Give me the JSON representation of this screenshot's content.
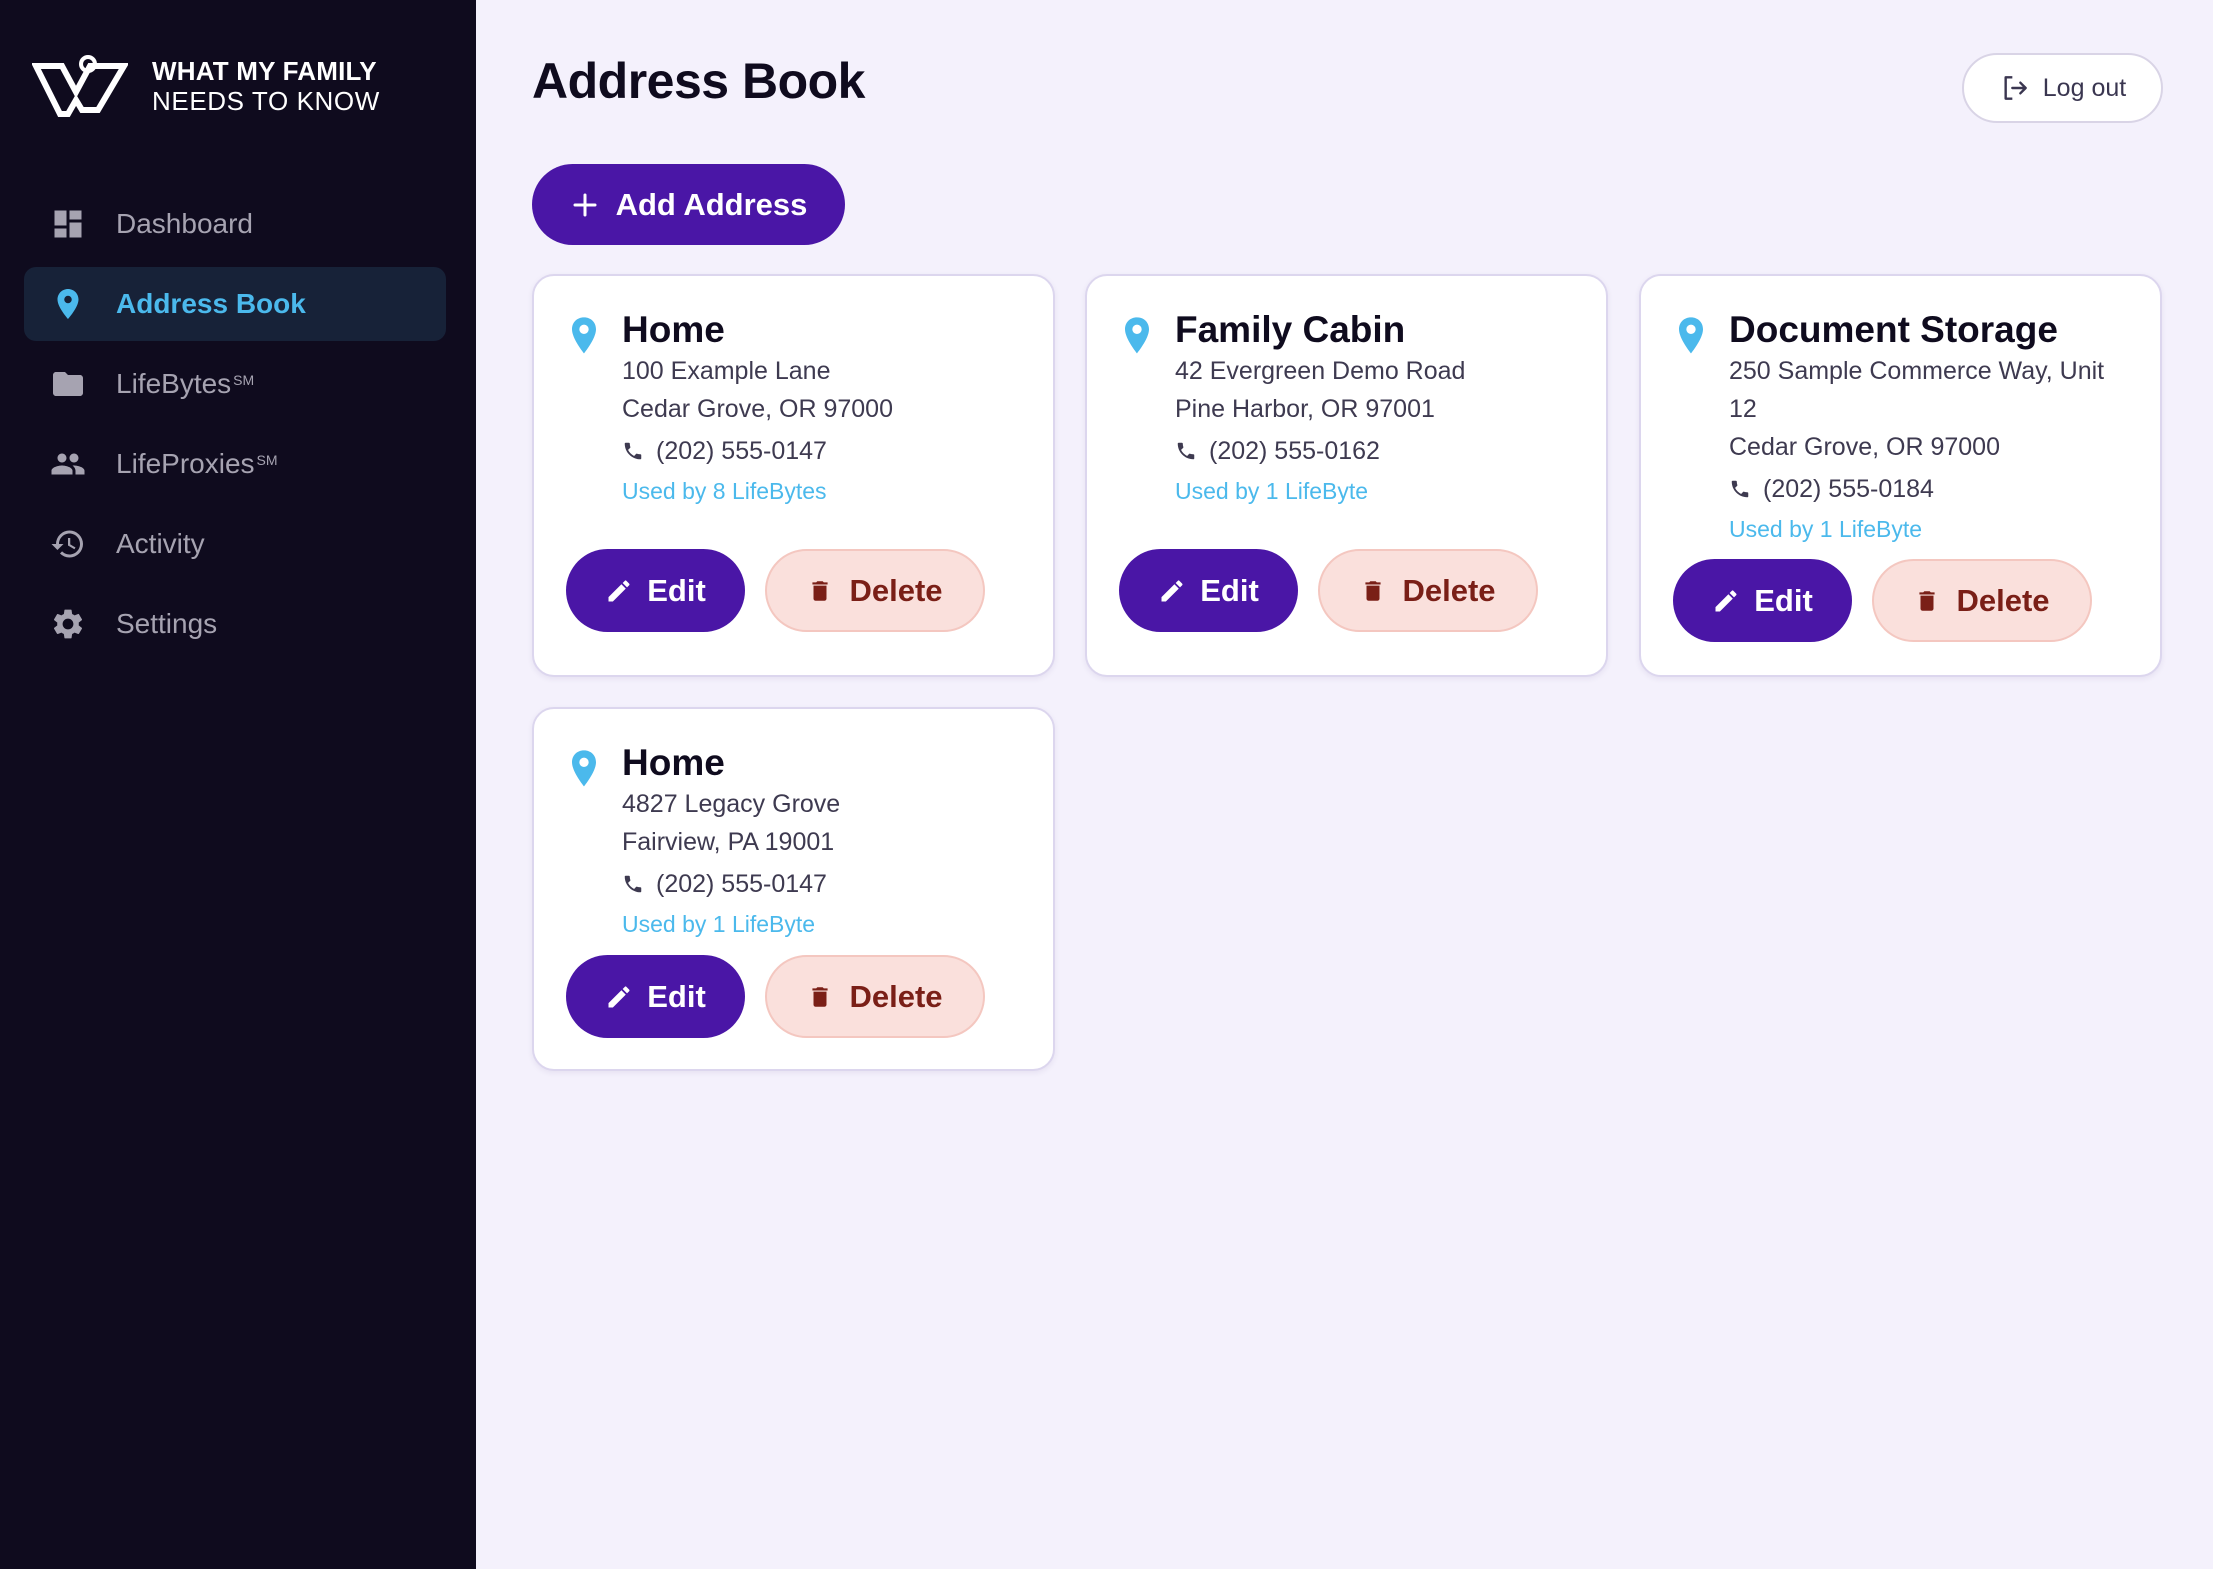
{
  "brand": {
    "line1": "WHAT MY FAMILY",
    "line2": "NEEDS TO KNOW"
  },
  "sidebar": {
    "items": [
      {
        "label": "Dashboard",
        "icon": "dashboard-icon",
        "active": false
      },
      {
        "label": "Address Book",
        "icon": "location-pin-icon",
        "active": true
      },
      {
        "label": "LifeBytes",
        "sup": "SM",
        "icon": "folder-icon",
        "active": false
      },
      {
        "label": "LifeProxies",
        "sup": "SM",
        "icon": "people-icon",
        "active": false
      },
      {
        "label": "Activity",
        "icon": "history-icon",
        "active": false
      },
      {
        "label": "Settings",
        "icon": "gear-icon",
        "active": false
      }
    ]
  },
  "header": {
    "title": "Address Book",
    "logout_label": "Log out"
  },
  "toolbar": {
    "add_label": "Add Address"
  },
  "buttons": {
    "edit_label": "Edit",
    "delete_label": "Delete"
  },
  "colors": {
    "sidebar_bg": "#0f0b1e",
    "page_bg": "#f4f1fc",
    "primary": "#4a16a6",
    "accent": "#4bb9ec",
    "danger_bg": "#fae0dc",
    "danger_text": "#7a1f17"
  },
  "addresses": [
    {
      "name": "Home",
      "lines": [
        "100 Example Lane",
        "Cedar Grove, OR 97000"
      ],
      "phone": "(202) 555-0147",
      "used_by": "Used by 8 LifeBytes"
    },
    {
      "name": "Family Cabin",
      "lines": [
        "42 Evergreen Demo Road",
        "Pine Harbor, OR 97001"
      ],
      "phone": "(202) 555-0162",
      "used_by": "Used by 1 LifeByte"
    },
    {
      "name": "Document Storage",
      "lines": [
        "250 Sample Commerce Way, Unit",
        "12",
        "Cedar Grove, OR 97000"
      ],
      "phone": "(202) 555-0184",
      "used_by": "Used by 1 LifeByte"
    },
    {
      "name": "Home",
      "lines": [
        "4827 Legacy Grove",
        "Fairview, PA 19001"
      ],
      "phone": "(202) 555-0147",
      "used_by": "Used by 1 LifeByte"
    }
  ]
}
